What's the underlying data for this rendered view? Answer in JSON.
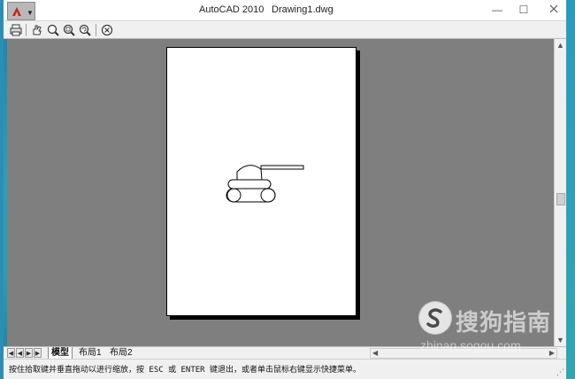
{
  "window": {
    "app_name": "AutoCAD 2010",
    "document_name": "Drawing1.dwg",
    "minimize_glyph": "—",
    "maximize_glyph": "☐"
  },
  "toolbar": {
    "buttons": [
      {
        "icon": "print-icon"
      },
      {
        "icon": "pan-icon"
      },
      {
        "icon": "zoom-realtime-icon"
      },
      {
        "icon": "zoom-window-icon"
      },
      {
        "icon": "zoom-original-icon"
      },
      {
        "icon": "close-preview-icon"
      }
    ]
  },
  "layout_tabs": {
    "tabs": [
      "模型",
      "布局1",
      "布局2"
    ],
    "active": "模型"
  },
  "status": {
    "message": "按住拾取键并垂直拖动以进行缩放，按 ESC 或 ENTER 键退出，或者单击鼠标右键显示快捷菜单。"
  },
  "watermark": {
    "brand": "搜狗指南",
    "url": "zhinan.sogou.com"
  },
  "colors": {
    "viewport_bg": "#7f7f7f",
    "paper": "#ffffff",
    "desktop": "#2a9dbd"
  }
}
